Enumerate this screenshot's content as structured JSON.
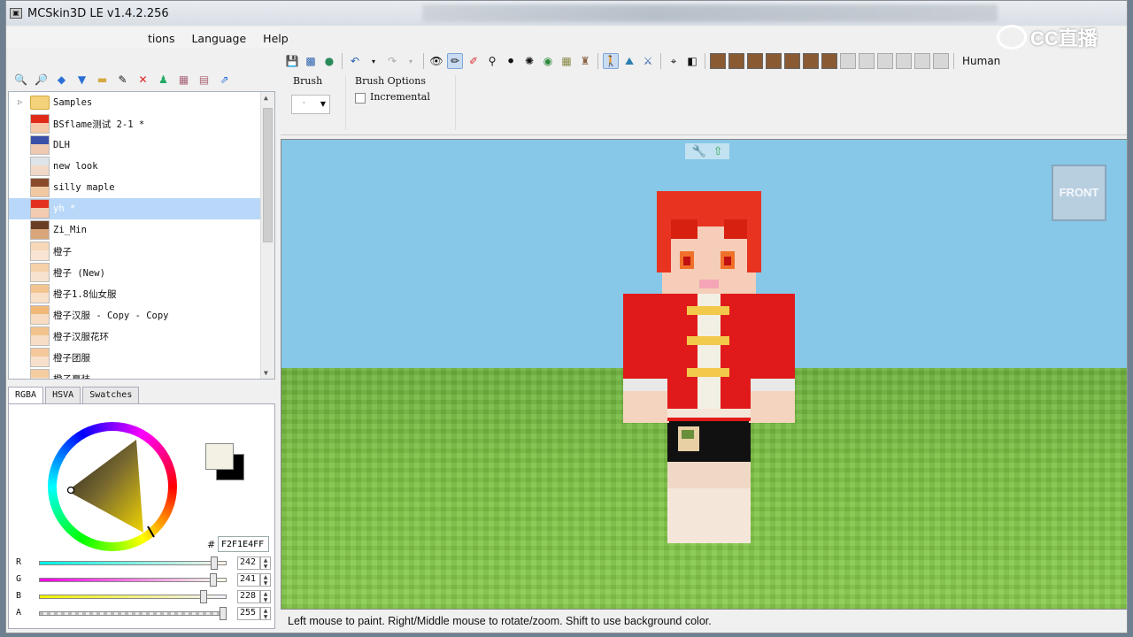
{
  "window": {
    "title": "MCSkin3D LE v1.4.2.256",
    "app_icon": "mcskin3d-icon"
  },
  "watermark": {
    "text": "CC直播"
  },
  "menu": {
    "items": [
      "tions",
      "Language",
      "Help"
    ]
  },
  "skins": {
    "items": [
      {
        "label": "Samples",
        "kind": "folder"
      },
      {
        "label": "BSflame测试 2-1 *",
        "kind": "skin",
        "hair": "#e02a1a",
        "face": "#f5c8a8"
      },
      {
        "label": "DLH",
        "kind": "skin",
        "hair": "#3a4fa8",
        "face": "#eec9b0"
      },
      {
        "label": "new look",
        "kind": "skin",
        "hair": "#dfe4e8",
        "face": "#f2d9c7"
      },
      {
        "label": "silly maple",
        "kind": "skin",
        "hair": "#8a4a2a",
        "face": "#f0c9a3"
      },
      {
        "label": "yh *",
        "kind": "skin",
        "hair": "#e33120",
        "face": "#f3cbb0",
        "selected": true
      },
      {
        "label": "Zi_Min",
        "kind": "skin",
        "hair": "#6a3d25",
        "face": "#d9a67c"
      },
      {
        "label": "橙子",
        "kind": "skin",
        "hair": "#f6d7b8",
        "face": "#f8e4d2"
      },
      {
        "label": "橙子 (New)",
        "kind": "skin",
        "hair": "#f5d0a8",
        "face": "#f8e2cf"
      },
      {
        "label": "橙子1.8仙女服",
        "kind": "skin",
        "hair": "#f3c48f",
        "face": "#f8e0c9"
      },
      {
        "label": "橙子汉服 - Copy - Copy",
        "kind": "skin",
        "hair": "#f1b878",
        "face": "#f7dcc2"
      },
      {
        "label": "橙子汉服花环",
        "kind": "skin",
        "hair": "#f2c38c",
        "face": "#f7ddc5"
      },
      {
        "label": "橙子团服",
        "kind": "skin",
        "hair": "#f4c89a",
        "face": "#f8e1cc"
      },
      {
        "label": "橙子夏装",
        "kind": "skin",
        "hair": "#f5cda0",
        "face": "#f8e3cf"
      }
    ]
  },
  "color_tabs": [
    "RGBA",
    "HSVA",
    "Swatches"
  ],
  "color": {
    "hex_label": "#",
    "hex": "F2F1E4FF",
    "primary": "#f2f1e4",
    "secondary": "#000000",
    "channels": [
      {
        "label": "R",
        "value": "242",
        "gradient": "linear-gradient(90deg,#00f1e4,#fff1e4)"
      },
      {
        "label": "G",
        "value": "241",
        "gradient": "linear-gradient(90deg,#f200e4,#f2ffe4)"
      },
      {
        "label": "B",
        "value": "228",
        "gradient": "linear-gradient(90deg,#f2f100,#f2f1ff)"
      },
      {
        "label": "A",
        "value": "255",
        "gradient": "repeating-linear-gradient(90deg,#bbb 0 4px,#eee 4px 8px)"
      }
    ]
  },
  "toolbar": {
    "model": "Human"
  },
  "brush": {
    "title": "Brush",
    "value": "·"
  },
  "brush_options": {
    "title": "Brush Options",
    "incremental": "Incremental"
  },
  "viewport": {
    "view_label": "FRONT",
    "sky": "#87c8e8"
  },
  "status": {
    "text": "Left mouse to paint. Right/Middle mouse to rotate/zoom. Shift to use background color."
  }
}
